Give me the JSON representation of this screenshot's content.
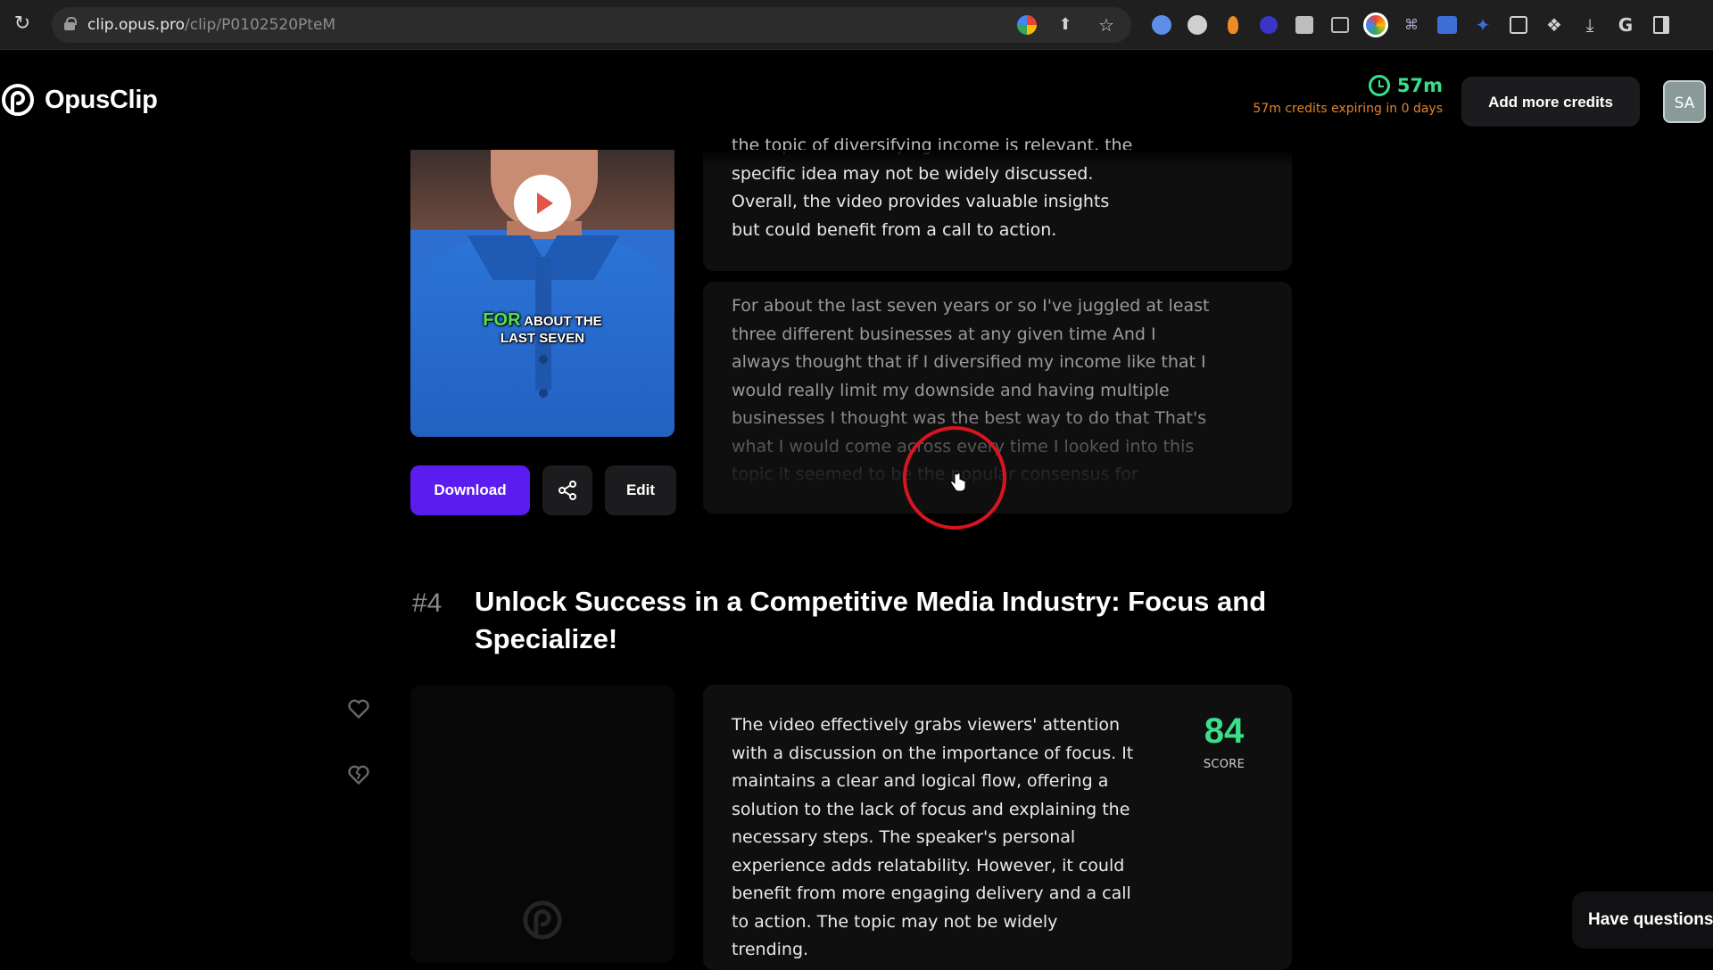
{
  "browser": {
    "url_host": "clip.opus.pro",
    "url_path": "/clip/P0102520PteM",
    "reload_icon": "reload-icon",
    "lock_icon": "lock-icon"
  },
  "header": {
    "logo_text": "OpusClip",
    "credits_value": "57m",
    "credits_note": "57m credits expiring in 0 days",
    "add_credits_label": "Add more credits",
    "avatar_initials": "SA"
  },
  "clip3": {
    "caption_highlight": "FOR",
    "caption_rest_line1": "ABOUT THE",
    "caption_line2": "LAST SEVEN",
    "summary_lines": [
      "the topic of diversifying income is relevant, the",
      "specific idea may not be widely discussed.",
      "Overall, the video provides valuable insights",
      "but could benefit from a call to action."
    ],
    "transcript_lines": [
      "For about the last seven years or so I've juggled at least",
      "three different businesses at any given time And I",
      "always thought that if I diversified my income like that I",
      "would really limit my downside and having multiple",
      "businesses I thought was the best way to do that That's",
      "what I would come across every time I looked into this",
      "topic it seemed to be the popular consensus for"
    ],
    "download_label": "Download",
    "edit_label": "Edit"
  },
  "clip4": {
    "number": "#4",
    "title": "Unlock Success in a Competitive Media Industry: Focus and Specialize!",
    "summary_lines": [
      "The video effectively grabs viewers' attention",
      "with a discussion on the importance of focus. It",
      "maintains a clear and logical flow, offering a",
      "solution to the lack of focus and explaining the",
      "necessary steps. The speaker's personal",
      "experience adds relatability. However, it could",
      "benefit from more engaging delivery and a call",
      "to action. The topic may not be widely",
      "trending."
    ],
    "score": "84",
    "score_label": "SCORE"
  },
  "help_widget": {
    "label": "Have questions?"
  },
  "colors": {
    "accent_purple": "#5b1cf0",
    "score_green": "#39e089",
    "credits_orange": "#e0832c",
    "click_ring_red": "#d8141f"
  }
}
